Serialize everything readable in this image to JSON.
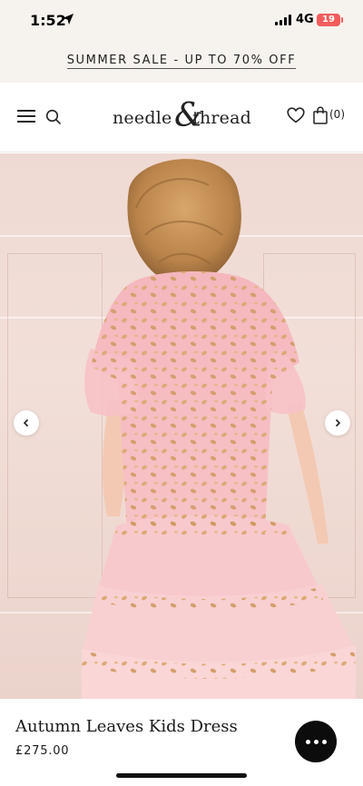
{
  "status_bar": {
    "time": "1:52",
    "network": "4G",
    "battery": "19"
  },
  "promo": {
    "text": "SUMMER SALE - UP TO 70% OFF"
  },
  "header": {
    "logo_left": "needle",
    "logo_amp": "&",
    "logo_right": "thread",
    "bag_count": "(0)"
  },
  "product": {
    "title": "Autumn Leaves Kids Dress",
    "price": "£275.00"
  },
  "colors": {
    "dress": "#f6b8be",
    "sequin": "#d9a566",
    "background": "#f0dcd5"
  },
  "icons": [
    "location-arrow-icon",
    "signal-icon",
    "menu-icon",
    "search-icon",
    "heart-icon",
    "shopping-bag-icon",
    "chevron-left-icon",
    "chevron-right-icon",
    "chat-icon"
  ]
}
